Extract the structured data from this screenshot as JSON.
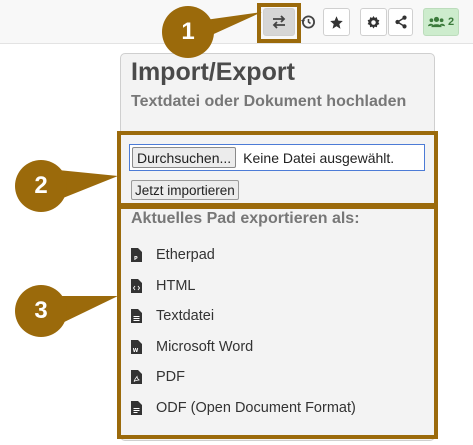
{
  "toolbar": {
    "users_count": "2",
    "buttons": [
      {
        "icon": "import-export-icon",
        "active": true
      },
      {
        "icon": "history-icon"
      },
      {
        "icon": "star-icon"
      },
      {
        "icon": "gear-icon"
      },
      {
        "icon": "share-icon"
      },
      {
        "icon": "users-icon"
      }
    ]
  },
  "panel": {
    "title": "Import/Export",
    "subtitle": "Textdatei oder Dokument hochladen",
    "file_button_label": "Durchsuchen...",
    "file_status": "Keine Datei ausgewählt.",
    "import_button_label": "Jetzt importieren",
    "export_heading": "Aktuelles Pad exportieren als:",
    "export_options": [
      {
        "label": "Etherpad",
        "icon": "etherpad-file-icon"
      },
      {
        "label": "HTML",
        "icon": "html-file-icon"
      },
      {
        "label": "Textdatei",
        "icon": "text-file-icon"
      },
      {
        "label": "Microsoft Word",
        "icon": "word-file-icon"
      },
      {
        "label": "PDF",
        "icon": "pdf-file-icon"
      },
      {
        "label": "ODF (Open Document Format)",
        "icon": "odf-file-icon"
      }
    ]
  },
  "callouts": [
    "1",
    "2",
    "3"
  ],
  "colors": {
    "callout": "#9b6a0b",
    "users_badge_bg": "#cdeccd",
    "file_input_border": "#4c7bd6"
  }
}
